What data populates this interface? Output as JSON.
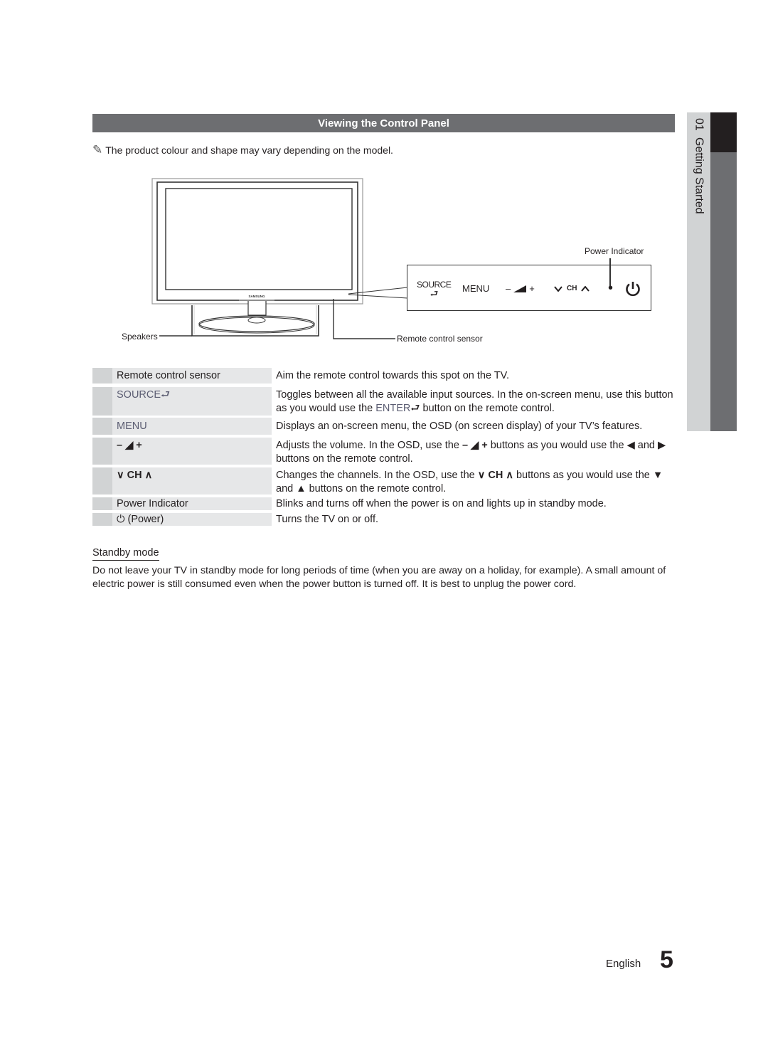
{
  "section": {
    "title": "Viewing the Control Panel",
    "note": "The product colour and shape may vary depending on the model.",
    "note_icon": "pencil-note-icon"
  },
  "diagram": {
    "tv_brand": "SAMSUNG",
    "labels": {
      "power_indicator": "Power Indicator",
      "speakers": "Speakers",
      "remote_sensor": "Remote control sensor"
    },
    "panel": {
      "source": "SOURCE",
      "menu": "MENU",
      "vol_minus": "–",
      "vol_plus": "+",
      "ch_down": "⌄",
      "ch": "CH",
      "ch_up": "⌃",
      "indicator": "•",
      "power": "⏻"
    }
  },
  "table": [
    {
      "key": "Remote control sensor",
      "desc": "Aim the remote control towards this spot on the TV."
    },
    {
      "key": "SOURCE",
      "key_icon": "⮐",
      "desc_a": "Toggles between all the available input sources. In the on-screen menu, use this button as you would use the ",
      "desc_enter": "ENTER",
      "desc_b": " button on the remote control."
    },
    {
      "key": "MENU",
      "desc": "Displays an on-screen menu, the OSD (on screen display) of your TV’s features."
    },
    {
      "key": "– ◢ +",
      "desc_a": "Adjusts the volume. In the OSD, use the ",
      "desc_icon": "– ◢ +",
      "desc_b": " buttons as you would use the ◀ and ▶ buttons on the remote control."
    },
    {
      "key": "∨ CH ∧",
      "desc_a": "Changes the channels. In the OSD, use the ",
      "desc_icon": "∨ CH ∧",
      "desc_b": " buttons as you would use the ▼ and ▲ buttons on the remote control."
    },
    {
      "key": "Power Indicator",
      "desc": "Blinks and turns off when the power is on and lights up in standby mode."
    },
    {
      "key_icon": "⏻",
      "key": "(Power)",
      "desc": "Turns the TV on or off."
    }
  ],
  "standby": {
    "title": "Standby mode",
    "body": "Do not leave your TV in standby mode for long periods of time (when you are away on a holiday, for example). A small amount of electric power is still consumed even when the power button is turned off. It is best to unplug the power cord."
  },
  "side_tab": {
    "number": "01",
    "label": "Getting Started"
  },
  "footer": {
    "language": "English",
    "page": "5"
  }
}
